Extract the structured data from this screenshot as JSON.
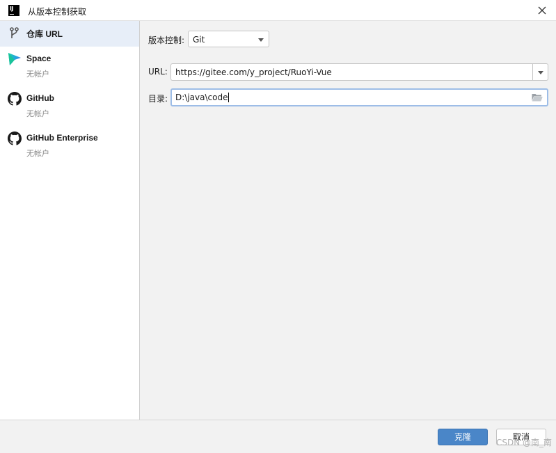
{
  "window": {
    "title": "从版本控制获取",
    "app_icon_text": "IJ"
  },
  "sidebar": {
    "items": [
      {
        "label": "仓库 URL",
        "icon": "git-branch-icon",
        "sub": ""
      },
      {
        "label": "Space",
        "icon": "space-logo-icon",
        "sub": "无帐户"
      },
      {
        "label": "GitHub",
        "icon": "github-icon",
        "sub": "无帐户"
      },
      {
        "label": "GitHub Enterprise",
        "icon": "github-icon",
        "sub": "无帐户"
      }
    ]
  },
  "form": {
    "vcs_label": "版本控制:",
    "vcs_value": "Git",
    "url_label": "URL:",
    "url_value": "https://gitee.com/y_project/RuoYi-Vue",
    "dir_label": "目录:",
    "dir_value": "D:\\java\\code"
  },
  "buttons": {
    "clone": "克隆",
    "cancel": "取消"
  },
  "watermark": "CSDN @南_南",
  "colors": {
    "accent": "#4a86c8",
    "selected_bg": "#e7eef8",
    "focus_border": "#9dbde7"
  }
}
